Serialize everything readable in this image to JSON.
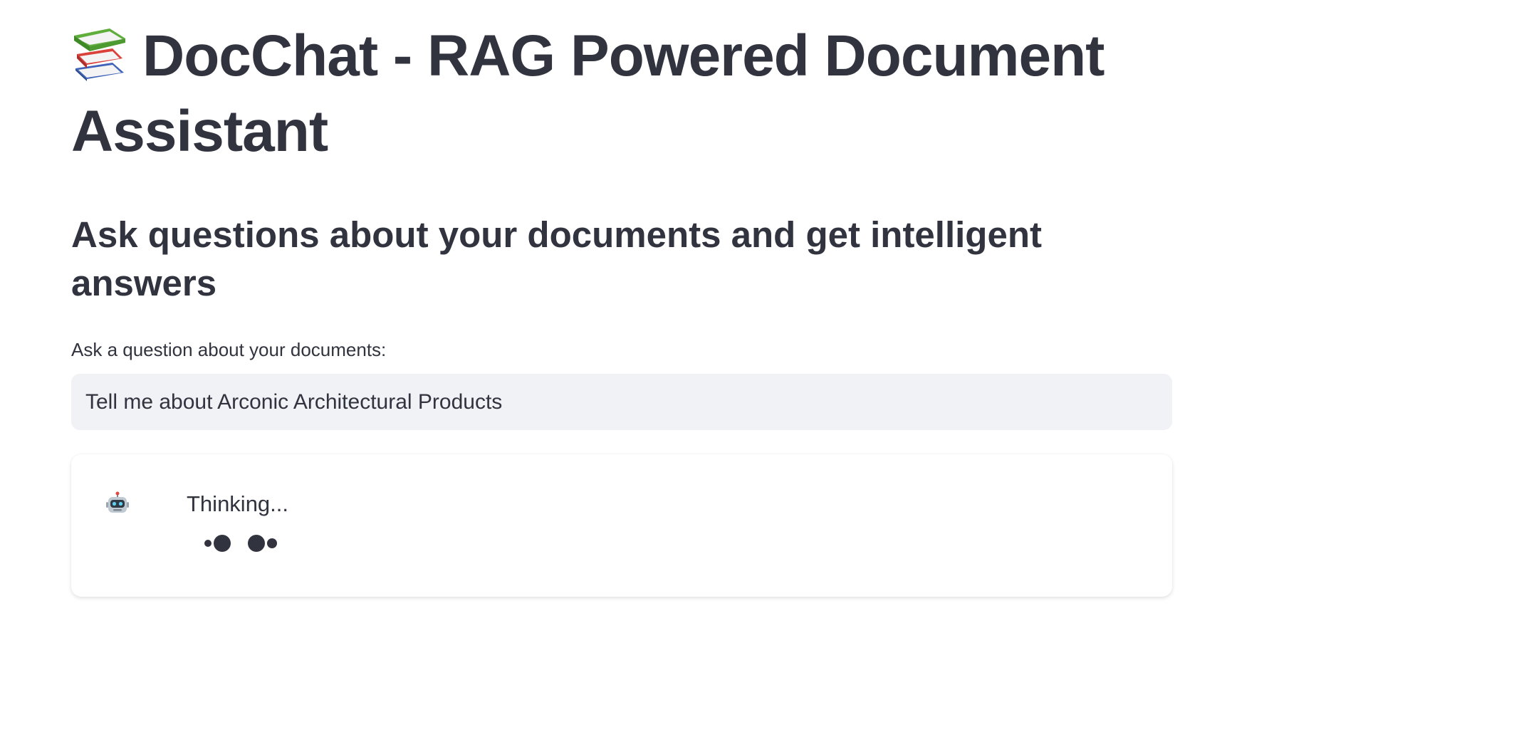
{
  "header": {
    "title": "DocChat - RAG Powered Document Assistant",
    "title_icon": "books-icon",
    "subtitle": "Ask questions about your documents and get intelligent answers"
  },
  "query": {
    "label": "Ask a question about your documents:",
    "value": "Tell me about Arconic Architectural Products"
  },
  "response": {
    "avatar_icon": "robot-icon",
    "status_text": "Thinking...",
    "loading_icon": "loading-dots-icon"
  },
  "colors": {
    "text": "#31333f",
    "input_background": "#f0f2f6",
    "page_background": "#ffffff"
  }
}
